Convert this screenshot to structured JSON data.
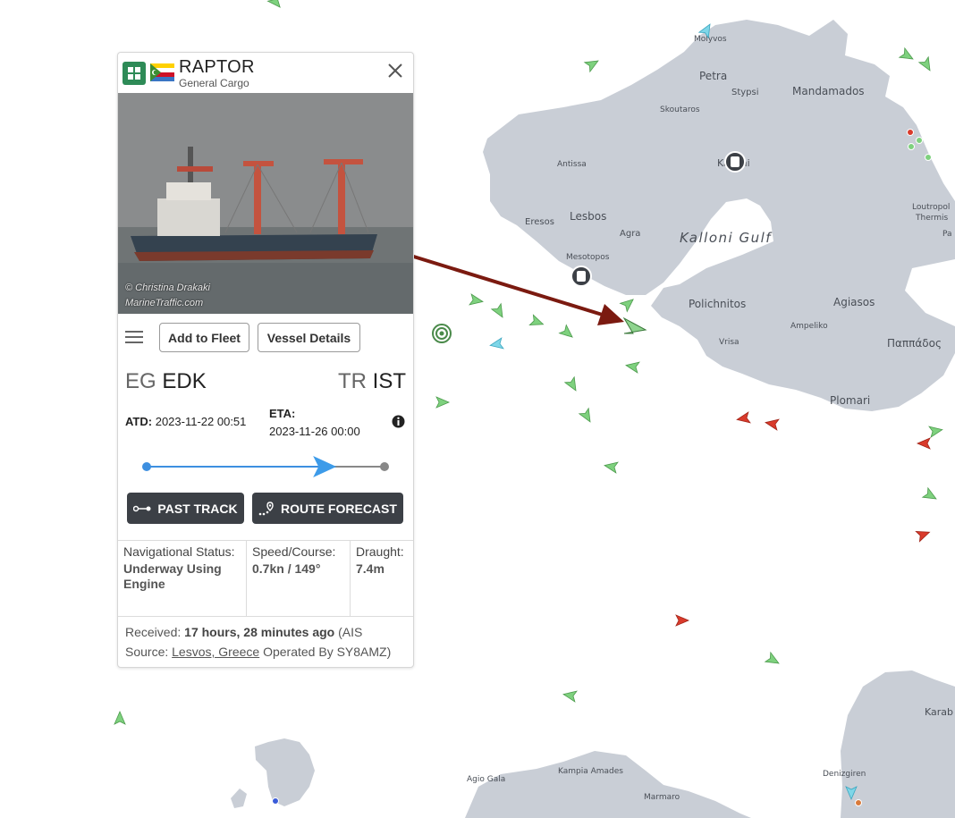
{
  "map": {
    "places": [
      {
        "name": "Molyvos"
      },
      {
        "name": "Petra"
      },
      {
        "name": "Stypsi"
      },
      {
        "name": "Mandamados"
      },
      {
        "name": "Skoutaros"
      },
      {
        "name": "Antissa"
      },
      {
        "name": "Kalloni"
      },
      {
        "name": "Eresos"
      },
      {
        "name": "Lesbos"
      },
      {
        "name": "Agra"
      },
      {
        "name": "Kalloni Gulf"
      },
      {
        "name": "Mesotopos"
      },
      {
        "name": "Polichnitos"
      },
      {
        "name": "Agiasos"
      },
      {
        "name": "Ampeliko"
      },
      {
        "name": "Vrisa"
      },
      {
        "name": "Παππάδος"
      },
      {
        "name": "Plomari"
      },
      {
        "name": "Loutropol"
      },
      {
        "name": "Thermis"
      },
      {
        "name": "Pa"
      },
      {
        "name": "Agio Gala"
      },
      {
        "name": "Kampia Amades"
      },
      {
        "name": "Marmaro"
      },
      {
        "name": "Denizgiren"
      },
      {
        "name": "Karab"
      }
    ],
    "colors": {
      "land": "#c9ced6",
      "sea": "#ffffff",
      "route_arrow": "#7b1a10",
      "vessel_green": "#7ed17e",
      "vessel_red": "#d93a2b",
      "vessel_cyan": "#7ed6e8"
    }
  },
  "vessel": {
    "name": "RAPTOR",
    "type": "General Cargo",
    "type_icon": "general-cargo-icon",
    "flag": "comoros-flag",
    "photo_credit_1": "© Christina Drakaki",
    "photo_credit_2": "MarineTraffic.com"
  },
  "actions": {
    "add_to_fleet": "Add to Fleet",
    "vessel_details": "Vessel Details",
    "past_track": "PAST TRACK",
    "route_forecast": "ROUTE FORECAST"
  },
  "voyage": {
    "origin_country": "EG",
    "origin_port": "EDK",
    "dest_country": "TR",
    "dest_port": "IST",
    "atd_label": "ATD:",
    "atd_value": "2023-11-22 00:51",
    "eta_label": "ETA:",
    "eta_value": "2023-11-26 00:00",
    "progress": 0.76
  },
  "status": {
    "nav_label": "Navigational Status:",
    "nav_value": "Underway Using Engine",
    "speed_label": "Speed/Course:",
    "speed_value": "0.7kn / 149°",
    "draught_label": "Draught:",
    "draught_value": "7.4m"
  },
  "received": {
    "label": "Received:",
    "time": "17 hours, 28 minutes ago",
    "text_mid": "(AIS Source:",
    "source": "Lesvos, Greece",
    "text_end": "Operated By SY8AMZ)"
  }
}
